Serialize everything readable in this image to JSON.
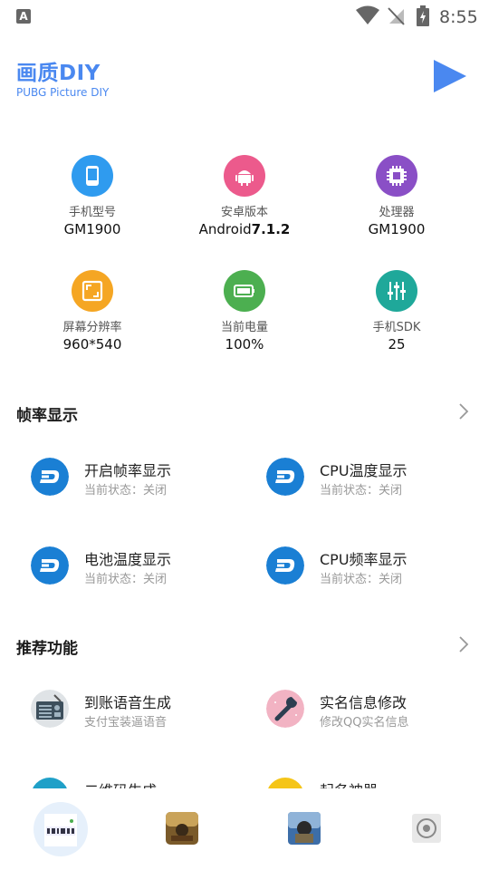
{
  "status_bar": {
    "time": "8:55",
    "notification_letter": "A"
  },
  "header": {
    "title": "画质DIY",
    "subtitle": "PUBG Picture DIY"
  },
  "device_info": [
    {
      "label": "手机型号",
      "value": "GM1900",
      "icon": "phone-icon",
      "color": "#2f9bef"
    },
    {
      "label": "安卓版本",
      "value_prefix": "Android",
      "value_bold": "7.1.2",
      "icon": "android-icon",
      "color": "#ec5a8c"
    },
    {
      "label": "处理器",
      "value": "GM1900",
      "icon": "cpu-icon",
      "color": "#8a4fc6"
    },
    {
      "label": "屏幕分辨率",
      "value": "960*540",
      "icon": "screen-icon",
      "color": "#f5a623"
    },
    {
      "label": "当前电量",
      "value": "100%",
      "icon": "battery-icon",
      "color": "#4caf50"
    },
    {
      "label": "手机SDK",
      "value": "25",
      "icon": "sliders-icon",
      "color": "#1fa89a"
    }
  ],
  "sections": {
    "fps": {
      "title": "帧率显示",
      "items": [
        {
          "title": "开启帧率显示",
          "subtitle": "当前状态：关闭"
        },
        {
          "title": "CPU温度显示",
          "subtitle": "当前状态：关闭"
        },
        {
          "title": "电池温度显示",
          "subtitle": "当前状态：关闭"
        },
        {
          "title": "CPU频率显示",
          "subtitle": "当前状态：关闭"
        }
      ]
    },
    "recommended": {
      "title": "推荐功能",
      "items": [
        {
          "title": "到账语音生成",
          "subtitle": "支付宝装逼语音"
        },
        {
          "title": "实名信息修改",
          "subtitle": "修改QQ实名信息"
        },
        {
          "title": "二维码生成",
          "subtitle": ""
        },
        {
          "title": "起名神器",
          "subtitle": ""
        }
      ]
    }
  },
  "colors": {
    "accent": "#4a88f0",
    "dash_blue": "#1a7fd4"
  }
}
